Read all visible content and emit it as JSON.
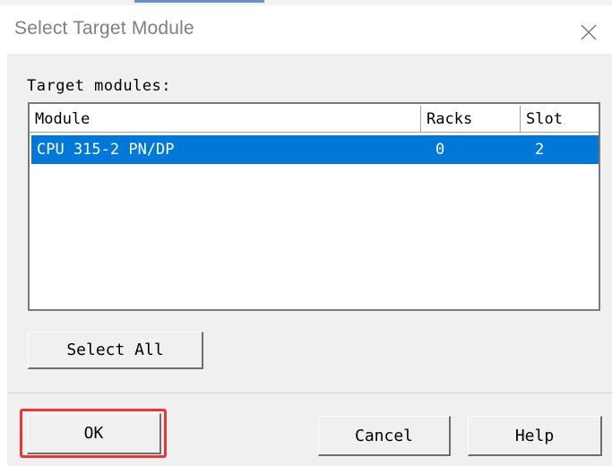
{
  "dialog": {
    "title": "Select Target Module"
  },
  "section_label": "Target  modules:",
  "table": {
    "columns": [
      "Module",
      "Racks",
      "Slot"
    ],
    "rows": [
      {
        "module": "CPU 315-2 PN/DP",
        "racks": "0",
        "slot": "2",
        "selected": true
      }
    ]
  },
  "buttons": {
    "select_all": "Select All",
    "ok": "OK",
    "cancel": "Cancel",
    "help": "Help"
  },
  "colors": {
    "selection": "#0078d7",
    "highlight_box": "#e53935",
    "dialog_bg": "#f0f0f0"
  },
  "icons": {
    "close": "close-icon"
  }
}
